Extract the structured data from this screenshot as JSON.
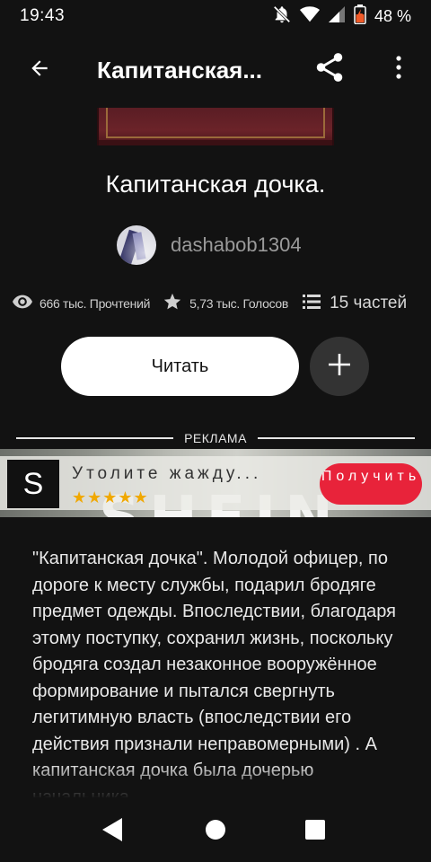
{
  "status_bar": {
    "time": "19:43",
    "battery_percent": "48 %",
    "battery_level": 0.48,
    "icons": [
      "notifications-off-icon",
      "wifi-icon",
      "cell-signal-icon",
      "battery-charging-icon"
    ]
  },
  "app_bar": {
    "title": "Капитанская...",
    "icons": [
      "back-arrow-icon",
      "share-icon",
      "more-vert-icon"
    ]
  },
  "story": {
    "title": "Капитанская дочка.",
    "author": "dashabob1304",
    "reads_label": "666 тыс. Прочтений",
    "votes_label": "5,73 тыс. Голосов",
    "parts_label": "15 частей",
    "read_button": "Читать",
    "description": "\"Капитанская дочка\". Молодой офицер, по дороге к месту службы, подарил бродяге предмет одежды. Впоследствии, благодаря этому поступку, сохранил жизнь, поскольку бродяга создал незаконное вооружённое формирование и пытался свергнуть легитимную власть (впоследствии его действия признали неправомерными) . А капитанская дочка была дочерью начальника"
  },
  "ad": {
    "label": "РЕКЛАМА",
    "logo_letter": "S",
    "text": "Утолите жажду...",
    "stars": "★★★★★",
    "star_rating": 5,
    "cta": "Получить",
    "brand_bg": "SHEIN",
    "cta_color": "#e8233a"
  },
  "nav": {
    "icons": [
      "nav-back-icon",
      "nav-home-icon",
      "nav-recents-icon"
    ]
  },
  "colors": {
    "background": "#121212",
    "button_white": "#ffffff",
    "add_button": "#333333",
    "author_text": "#9a9a9a"
  }
}
